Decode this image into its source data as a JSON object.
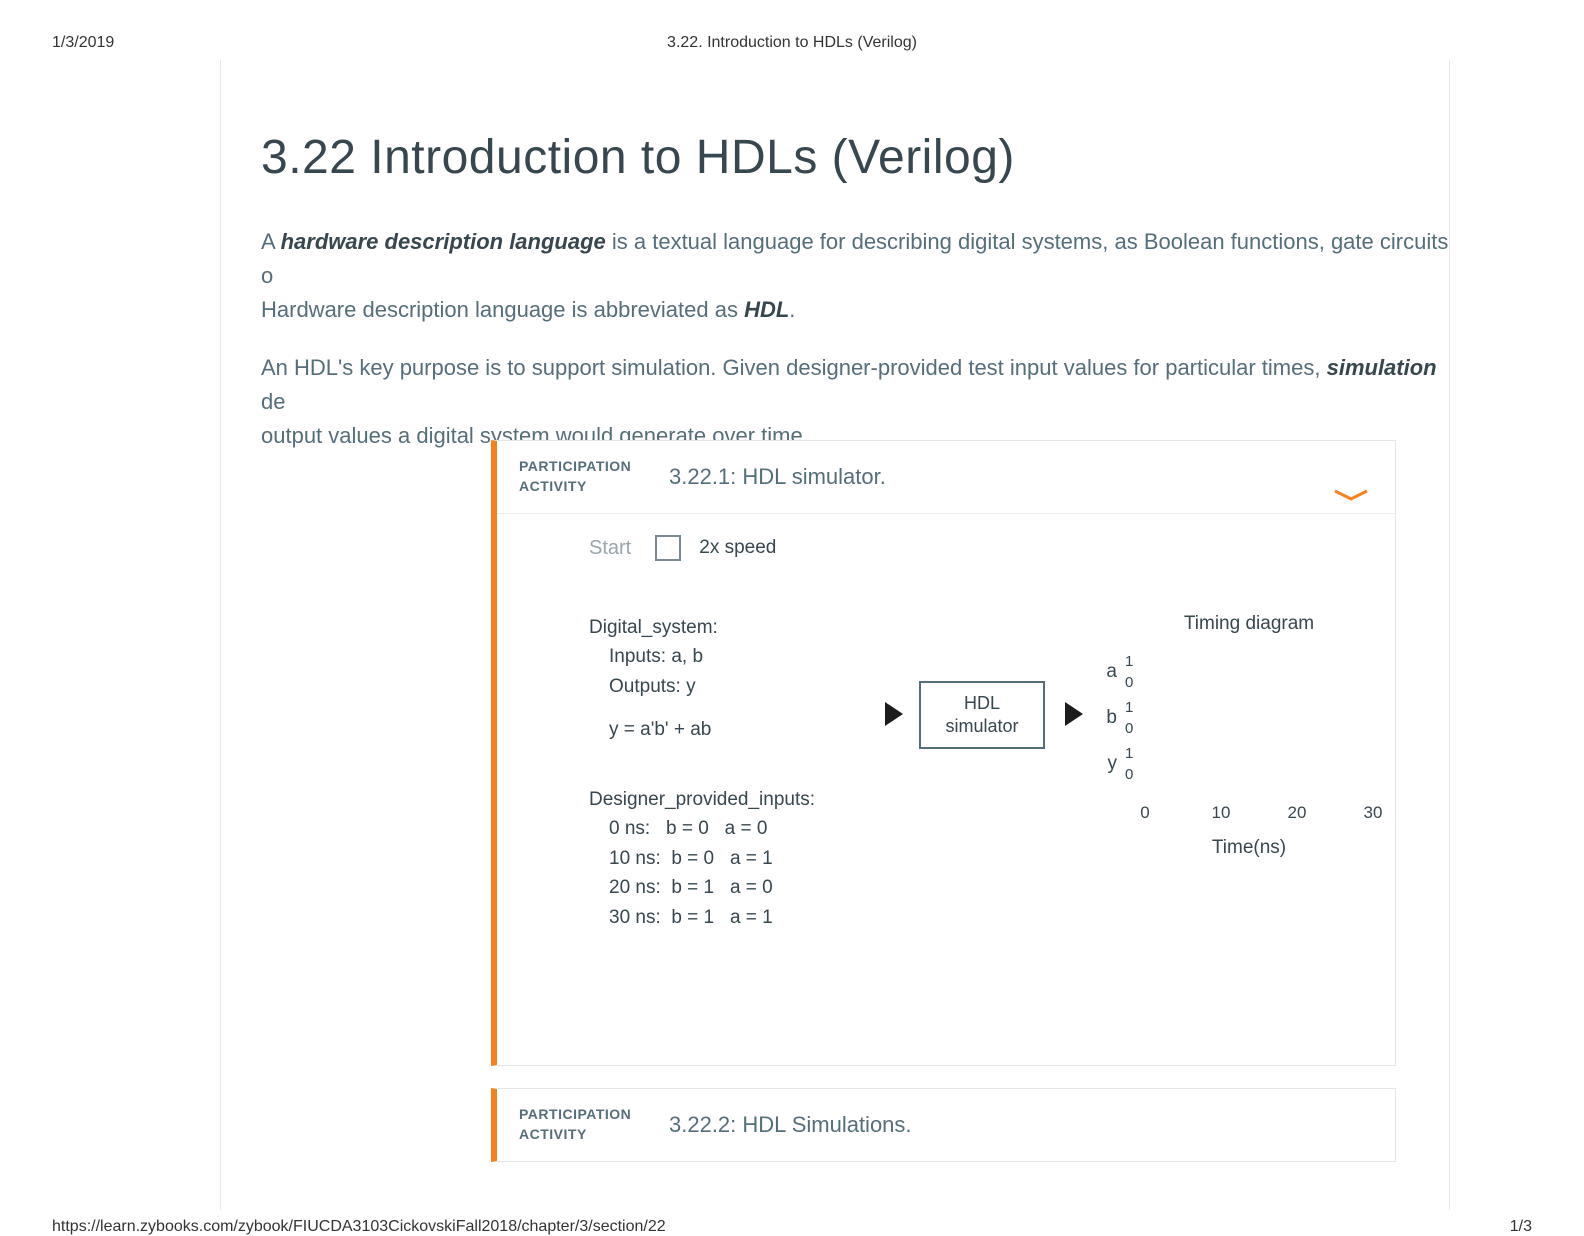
{
  "print": {
    "date": "1/3/2019",
    "doc_title": "3.22. Introduction to HDLs (Verilog)",
    "url": "https://learn.zybooks.com/zybook/FIUCDA3103CickovskiFall2018/chapter/3/section/22",
    "page_indicator": "1/3"
  },
  "page": {
    "title": "3.22 Introduction to HDLs (Verilog)",
    "p1_a": "A ",
    "p1_kw1": "hardware description language",
    "p1_b": " is a textual language for describing digital systems, as Boolean functions, gate circuits, o",
    "p1_c": "Hardware description language is abbreviated as ",
    "p1_kw2": "HDL",
    "p1_d": ".",
    "p2_a": "An HDL's key purpose is to support simulation. Given designer-provided test input values for particular times, ",
    "p2_kw1": "simulation",
    "p2_b": " de",
    "p2_c": "output values a digital system would generate over time."
  },
  "activity1": {
    "label_line1": "PARTICIPATION",
    "label_line2": "ACTIVITY",
    "title": "3.22.1: HDL simulator.",
    "start": "Start",
    "speed": "2x speed",
    "digital_system_header": "Digital_system:",
    "inputs": "Inputs: a, b",
    "outputs": "Outputs: y",
    "equation": "y = a'b' + ab",
    "sim_box_l1": "HDL",
    "sim_box_l2": "simulator",
    "dpi_header": "Designer_provided_inputs:",
    "dpi": [
      "0 ns:   b = 0   a = 0",
      "10 ns:  b = 0   a = 1",
      "20 ns:  b = 1   a = 0",
      "30 ns:  b = 1   a = 1"
    ],
    "timing": {
      "title": "Timing diagram",
      "signals": [
        "a",
        "b",
        "y"
      ],
      "level_hi": "1",
      "level_lo": "0",
      "ticks": [
        "0",
        "10",
        "20",
        "30"
      ],
      "xlabel": "Time(ns)"
    }
  },
  "activity2": {
    "label_line1": "PARTICIPATION",
    "label_line2": "ACTIVITY",
    "title": "3.22.2: HDL Simulations."
  },
  "chart_data": {
    "type": "table",
    "title": "Designer_provided_inputs",
    "columns": [
      "time_ns",
      "b",
      "a"
    ],
    "rows": [
      [
        0,
        0,
        0
      ],
      [
        10,
        0,
        1
      ],
      [
        20,
        1,
        0
      ],
      [
        30,
        1,
        1
      ]
    ],
    "equation": "y = a'b' + ab",
    "timing_xticks": [
      0,
      10,
      20,
      30
    ],
    "timing_signals": [
      "a",
      "b",
      "y"
    ],
    "xlabel": "Time(ns)"
  }
}
